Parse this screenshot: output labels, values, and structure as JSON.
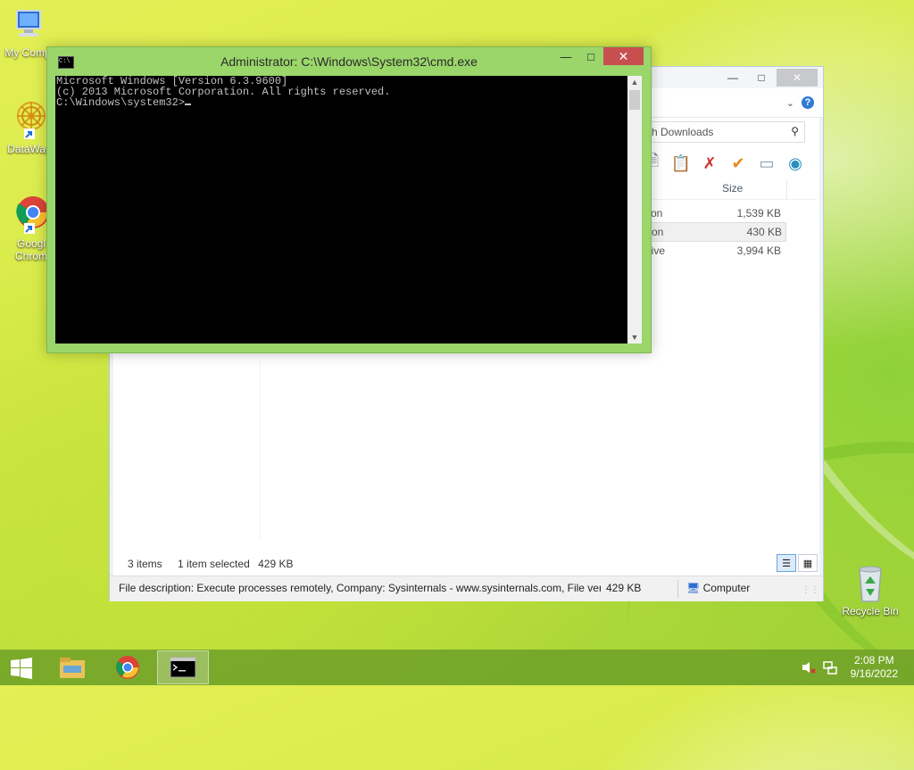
{
  "desktop": {
    "icons": [
      {
        "label": "My Comp",
        "icon": "computer-icon"
      },
      {
        "label": "DataWag",
        "icon": "datawag-shortcut-icon"
      },
      {
        "label": "Googl",
        "label2": "Chrom",
        "icon": "chrome-shortcut-icon"
      },
      {
        "label": "Recycle Bin",
        "icon": "recycle-bin-icon"
      }
    ]
  },
  "explorer": {
    "search_placeholder": "rch Downloads",
    "size_header": "Size",
    "files": [
      {
        "type": "tion",
        "size": "1,539 KB"
      },
      {
        "type": "tion",
        "size": "430 KB"
      },
      {
        "type": "hive",
        "size": "3,994 KB"
      }
    ],
    "status": {
      "items": "3 items",
      "selected": "1 item selected",
      "selected_size": "429 KB"
    },
    "info": {
      "description": "File description: Execute processes remotely, Company: Sysinternals - www.sysinternals.com, File versio",
      "size": "429 KB",
      "location": "Computer"
    }
  },
  "cmd": {
    "title": "Administrator: C:\\Windows\\System32\\cmd.exe",
    "lines": [
      "Microsoft Windows [Version 6.3.9600]",
      "(c) 2013 Microsoft Corporation. All rights reserved.",
      "",
      "C:\\Windows\\system32>"
    ]
  },
  "taskbar": {
    "clock_time": "2:08 PM",
    "clock_date": "9/16/2022"
  },
  "colors": {
    "cmd_frame": "#9bd66a",
    "cmd_close": "#c7504f",
    "taskbar": "#6ea028",
    "accent_blue": "#2e7bd4"
  }
}
